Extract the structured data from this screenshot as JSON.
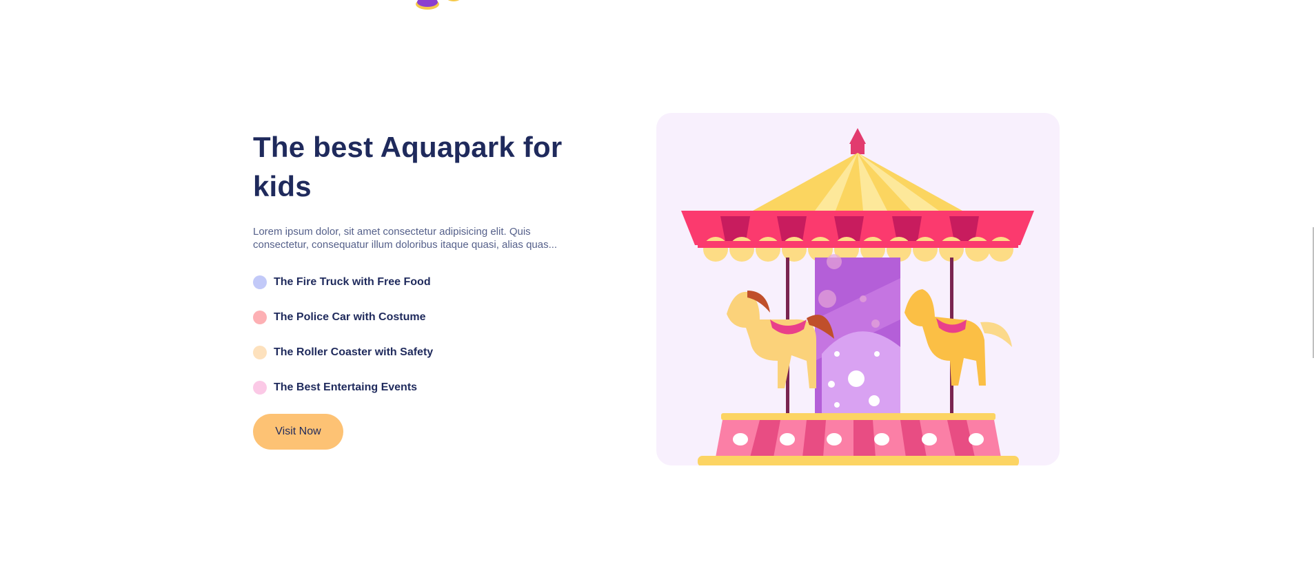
{
  "section": {
    "headline": "The best Aquapark for kids",
    "description": "Lorem ipsum dolor, sit amet consectetur adipisicing elit. Quis consectetur, consequatur illum doloribus itaque quasi, alias quas...",
    "features": [
      {
        "label": "The Fire Truck with Free Food",
        "color": "#c2c9f8"
      },
      {
        "label": "The Police Car with Costume",
        "color": "#fdb0b4"
      },
      {
        "label": "The Roller Coaster with Safety",
        "color": "#fde1bd"
      },
      {
        "label": "The Best Entertaing Events",
        "color": "#fbc9e6"
      }
    ],
    "cta_label": "Visit Now"
  },
  "illustration": {
    "icon": "carousel-illustration",
    "card_color": "#f8f0fd"
  },
  "colors": {
    "heading": "#1f2a5c",
    "button": "#fdc274",
    "canopy_pink": "#fb3a6e",
    "canopy_yellow": "#fde08b",
    "pole_purple": "#b45fd8"
  }
}
